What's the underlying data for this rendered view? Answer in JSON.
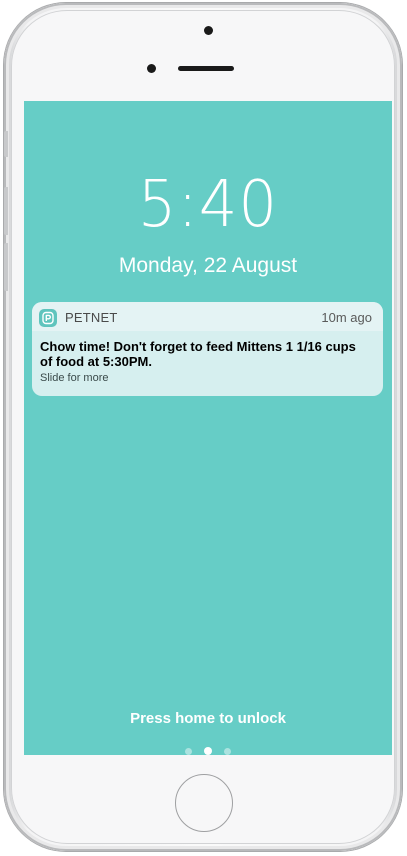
{
  "lockscreen": {
    "time": "5:40",
    "date": "Monday, 22 August",
    "background_color": "#66cdc6"
  },
  "notification": {
    "app_icon": "petnet-app-icon",
    "app_name": "PETNET",
    "time_ago": "10m ago",
    "message": "Chow time! Don't forget to feed Mittens 1 1/16 cups of food at 5:30PM.",
    "action_hint": "Slide for more"
  },
  "footer": {
    "unlock_text": "Press home to unlock",
    "page_indicator": {
      "pages": 3,
      "current": 2
    }
  }
}
